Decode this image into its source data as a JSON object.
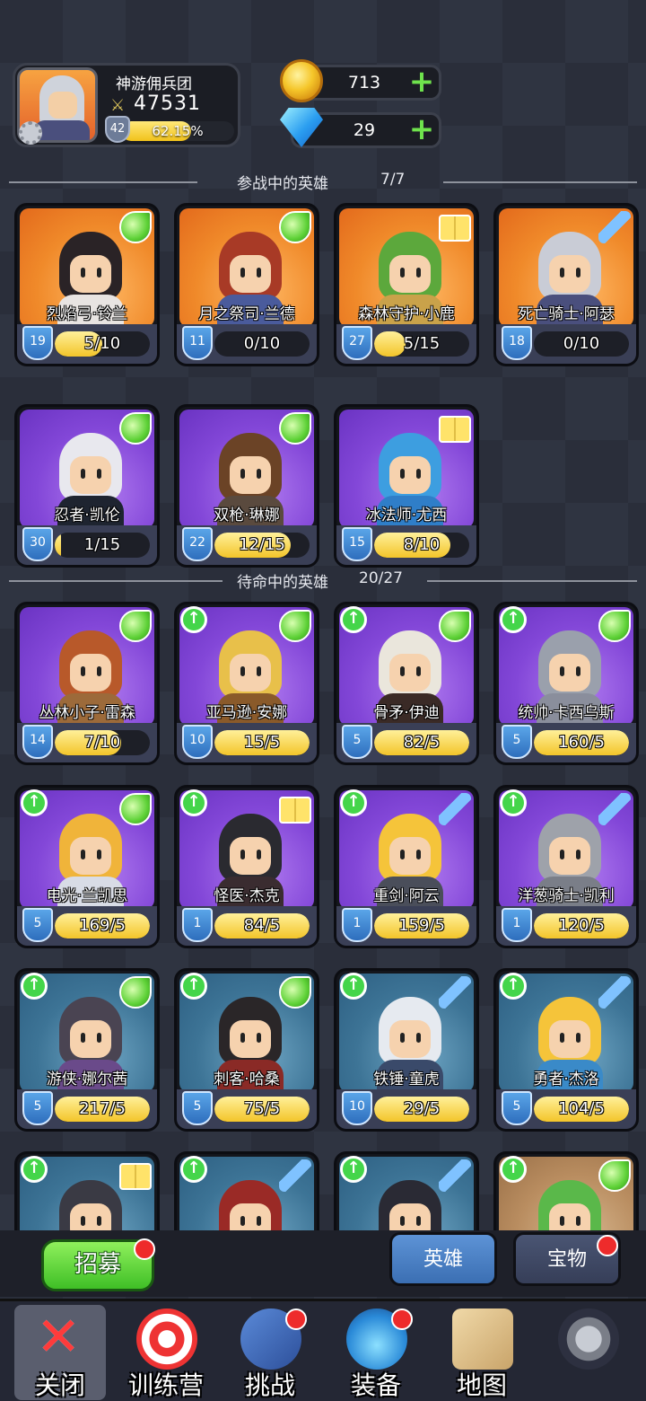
{
  "profile": {
    "guild_name": "神游佣兵团",
    "power": "47531",
    "level": "42",
    "exp_text": "62.15%",
    "exp_fraction": 0.6215
  },
  "currency": {
    "gold": "713",
    "diamonds": "29"
  },
  "active_section": {
    "title": "参战中的英雄",
    "count": "7/7"
  },
  "active_heroes": [
    {
      "name": "烈焰弓·铃兰",
      "level": "19",
      "shards": "5/10",
      "progress": 0.5,
      "rarity": "orange",
      "class": "wing",
      "hair": "#2a2326",
      "body": "#e8e4e2"
    },
    {
      "name": "月之祭司·兰德",
      "level": "11",
      "shards": "0/10",
      "progress": 0,
      "rarity": "orange",
      "class": "wing",
      "hair": "#a83a26",
      "body": "#4a5b9c"
    },
    {
      "name": "森林守护·小鹿",
      "level": "27",
      "shards": "5/15",
      "progress": 0.333,
      "rarity": "orange",
      "class": "book",
      "hair": "#5ca83c",
      "body": "#c9a24a"
    },
    {
      "name": "死亡骑士·阿瑟",
      "level": "18",
      "shards": "0/10",
      "progress": 0,
      "rarity": "orange",
      "class": "sword",
      "hair": "#c9ccd6",
      "body": "#4a4f7d"
    },
    {
      "name": "忍者·凯伦",
      "level": "30",
      "shards": "1/15",
      "progress": 0.067,
      "rarity": "purple",
      "class": "wing",
      "hair": "#e8e8ee",
      "body": "#1e2430"
    },
    {
      "name": "双枪·琳娜",
      "level": "22",
      "shards": "12/15",
      "progress": 0.8,
      "rarity": "purple",
      "class": "wing",
      "hair": "#6b4326",
      "body": "#5a4a3e"
    },
    {
      "name": "冰法师·尤西",
      "level": "15",
      "shards": "8/10",
      "progress": 0.8,
      "rarity": "purple",
      "class": "book",
      "hair": "#3d9ee0",
      "body": "#2f7ec8"
    }
  ],
  "reserve_section": {
    "title": "待命中的英雄",
    "count": "20/27"
  },
  "reserve_heroes": [
    {
      "name": "丛林小子·雷森",
      "level": "14",
      "shards": "7/10",
      "progress": 0.7,
      "rarity": "purple",
      "class": "wing",
      "upgrade": false,
      "hair": "#b8592a",
      "body": "#9c6a3a"
    },
    {
      "name": "亚马逊·安娜",
      "level": "10",
      "shards": "15/5",
      "progress": 1,
      "rarity": "purple",
      "class": "wing",
      "upgrade": true,
      "hair": "#e8c04a",
      "body": "#8a5a2a"
    },
    {
      "name": "骨矛·伊迪",
      "level": "5",
      "shards": "82/5",
      "progress": 1,
      "rarity": "purple",
      "class": "wing",
      "upgrade": true,
      "hair": "#eae6dc",
      "body": "#3a2a26"
    },
    {
      "name": "统帅·卡西乌斯",
      "level": "5",
      "shards": "160/5",
      "progress": 1,
      "rarity": "purple",
      "class": "wing",
      "upgrade": true,
      "hair": "#9aa0ac",
      "body": "#8a8e9c"
    },
    {
      "name": "电光·兰凯思",
      "level": "5",
      "shards": "169/5",
      "progress": 1,
      "rarity": "purple",
      "class": "wing",
      "upgrade": true,
      "hair": "#f0b43a",
      "body": "#d8dce6"
    },
    {
      "name": "怪医·杰克",
      "level": "1",
      "shards": "84/5",
      "progress": 1,
      "rarity": "purple",
      "class": "book",
      "upgrade": true,
      "hair": "#2a2a30",
      "body": "#3a2c30"
    },
    {
      "name": "重剑·阿云",
      "level": "1",
      "shards": "159/5",
      "progress": 1,
      "rarity": "purple",
      "class": "sword",
      "upgrade": true,
      "hair": "#f5c43a",
      "body": "#4a4e5a"
    },
    {
      "name": "洋葱骑士·凯利",
      "level": "1",
      "shards": "120/5",
      "progress": 1,
      "rarity": "purple",
      "class": "sword",
      "upgrade": true,
      "hair": "#9ea2aa",
      "body": "#7a7e88"
    },
    {
      "name": "游侠·娜尔茜",
      "level": "5",
      "shards": "217/5",
      "progress": 1,
      "rarity": "blue",
      "class": "wing",
      "upgrade": true,
      "hair": "#4a4452",
      "body": "#6a4a8a"
    },
    {
      "name": "刺客·哈桑",
      "level": "5",
      "shards": "75/5",
      "progress": 1,
      "rarity": "blue",
      "class": "wing",
      "upgrade": true,
      "hair": "#2a2628",
      "body": "#8a2a26"
    },
    {
      "name": "铁锤·童虎",
      "level": "10",
      "shards": "29/5",
      "progress": 1,
      "rarity": "blue",
      "class": "sword",
      "upgrade": true,
      "hair": "#e6eaf0",
      "body": "#3a4a6a"
    },
    {
      "name": "勇者·杰洛",
      "level": "5",
      "shards": "104/5",
      "progress": 1,
      "rarity": "blue",
      "class": "sword",
      "upgrade": true,
      "hair": "#f5c43a",
      "body": "#3a8ac8"
    },
    {
      "name": "",
      "level": "",
      "shards": "",
      "progress": 0,
      "rarity": "blue",
      "class": "book",
      "upgrade": true,
      "hair": "#3a3a44",
      "body": "#6a6e7a"
    },
    {
      "name": "",
      "level": "",
      "shards": "",
      "progress": 0,
      "rarity": "blue",
      "class": "sword",
      "upgrade": true,
      "hair": "#9a2a26",
      "body": "#c8ccd6"
    },
    {
      "name": "",
      "level": "",
      "shards": "",
      "progress": 0,
      "rarity": "blue",
      "class": "sword",
      "upgrade": true,
      "hair": "#2a2a34",
      "body": "#5a5e6a"
    },
    {
      "name": "",
      "level": "",
      "shards": "",
      "progress": 0,
      "rarity": "tan",
      "class": "wing",
      "upgrade": true,
      "hair": "#5ab84a",
      "body": "#e8c89a"
    }
  ],
  "actions": {
    "recruit_label": "招募",
    "tab_heroes": "英雄",
    "tab_treasure": "宝物"
  },
  "navbar": [
    {
      "label": "关闭",
      "icon": "close-icon"
    },
    {
      "label": "训练营",
      "icon": "target-icon"
    },
    {
      "label": "挑战",
      "icon": "sword-shield-icon"
    },
    {
      "label": "装备",
      "icon": "potion-icon"
    },
    {
      "label": "地图",
      "icon": "map-icon"
    },
    {
      "label": "",
      "icon": "lock-icon"
    }
  ],
  "colors": {
    "gold_fill": "#f3c52a",
    "level_blue": "#2e6ebd",
    "upgrade_green": "#44d54a",
    "notify_red": "#ee2b2b"
  }
}
